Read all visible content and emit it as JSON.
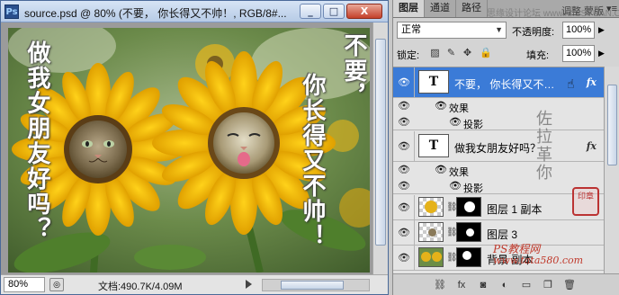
{
  "document": {
    "title": "source.psd @ 80% (不要，      你长得又不帅！, RGB/8#...",
    "window_buttons": [
      "_",
      "□",
      "X"
    ],
    "zoom": "80%",
    "doc_info": "文档:490.7K/4.09M",
    "canvas_text_left": "做我女朋友好吗？",
    "canvas_text_right_col1": "不要，",
    "canvas_text_right_col2": "你长得又不帅！"
  },
  "panel": {
    "tabs": [
      "图层",
      "通道",
      "路径"
    ],
    "tab_extra": "调整   蒙版",
    "top_watermark": "思缘设计论坛 www.MISSYUAN.COM",
    "blend_mode": "正常",
    "opacity_label": "不透明度:",
    "opacity_value": "100%",
    "lock_label": "锁定:",
    "fill_label": "填充:",
    "fill_value": "100%",
    "layers": [
      {
        "name": "不要，     你长得又不…",
        "type": "text",
        "thumb": "T",
        "fx": "fx",
        "selected": true
      },
      {
        "name": "效果",
        "type": "effects"
      },
      {
        "name": "投影",
        "type": "effect"
      },
      {
        "name": "做我女朋友好吗？",
        "type": "text",
        "thumb": "T",
        "fx": "fx"
      },
      {
        "name": "效果",
        "type": "effects"
      },
      {
        "name": "投影",
        "type": "effect"
      },
      {
        "name": "图层 1 副本",
        "type": "image"
      },
      {
        "name": "图层 3",
        "type": "image"
      },
      {
        "name": "背景 副本",
        "type": "image"
      }
    ],
    "signature": "佐拉革你",
    "seal_text": "印章",
    "site_mark_1": "PS教程网",
    "site_mark_2": "www.tata580.com"
  },
  "icons": {
    "eye": "eye-icon",
    "chain": "chain-link-icon",
    "lock_transparent": "lock-transparency-icon",
    "lock_paint": "lock-paint-icon",
    "lock_move": "lock-position-icon",
    "lock_all": "lock-all-icon",
    "menu": "panel-menu-icon"
  },
  "colors": {
    "selection": "#3b7bd7",
    "title_gradient_top": "#d6e4f5",
    "close_button": "#c4402a"
  }
}
